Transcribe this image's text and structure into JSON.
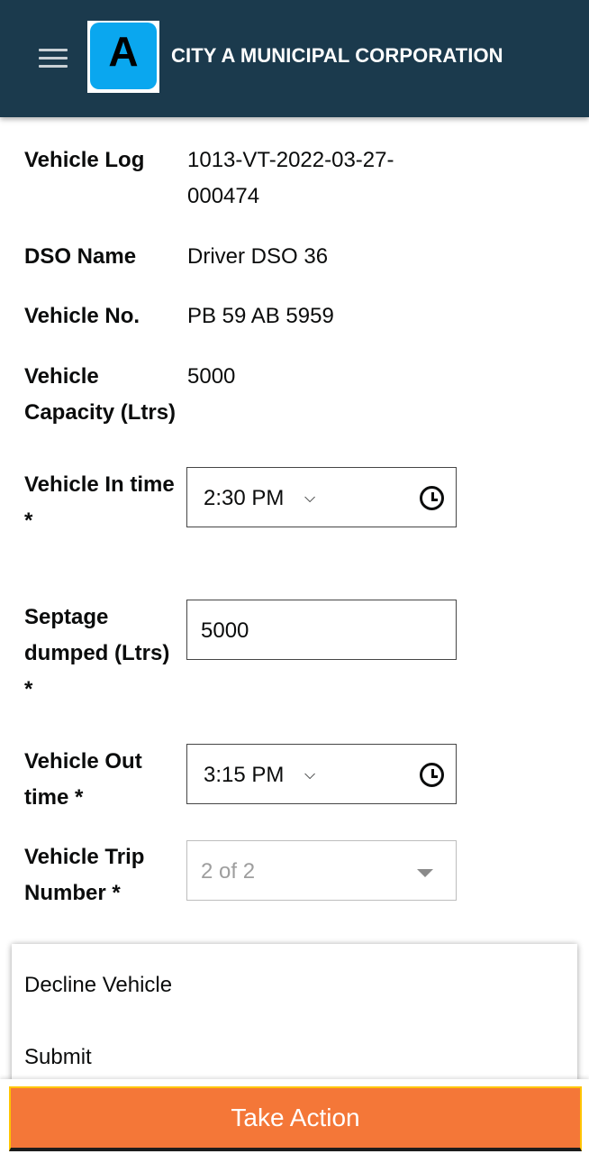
{
  "header": {
    "menu_icon": "hamburger-icon",
    "logo_letter": "A",
    "logo_color": "#0aa7ef",
    "city_name": "CITY A MUNICIPAL CORPORATION",
    "background": "#1b3a4d"
  },
  "details": {
    "vehicle_log_label": "Vehicle Log",
    "vehicle_log_value_line1": "1013-VT-2022-03-27-",
    "vehicle_log_value_line2": "000474",
    "dso_name_label": "DSO Name",
    "dso_name_value": "Driver DSO 36",
    "vehicle_no_label": "Vehicle No.",
    "vehicle_no_value": "PB 59 AB 5959",
    "capacity_label_line1": "Vehicle",
    "capacity_label_line2": "Capacity (Ltrs)",
    "capacity_value": "5000"
  },
  "form": {
    "in_time_label_line1": "Vehicle In time",
    "in_time_label_line2": "*",
    "in_time_value": "2:30  PM",
    "septage_label_line1": "Septage",
    "septage_label_line2": "dumped (Ltrs)",
    "septage_label_line3": "*",
    "septage_value": "5000",
    "out_time_label_line1": "Vehicle Out",
    "out_time_label_line2": "time *",
    "out_time_value": "3:15  PM",
    "trip_label_line1": "Vehicle Trip",
    "trip_label_line2": "Number *",
    "trip_value": "2 of 2",
    "caret": "⌵"
  },
  "action_menu": {
    "items": [
      "Decline Vehicle",
      "Submit"
    ]
  },
  "footer": {
    "take_action_label": "Take Action",
    "button_color": "#f47738"
  }
}
